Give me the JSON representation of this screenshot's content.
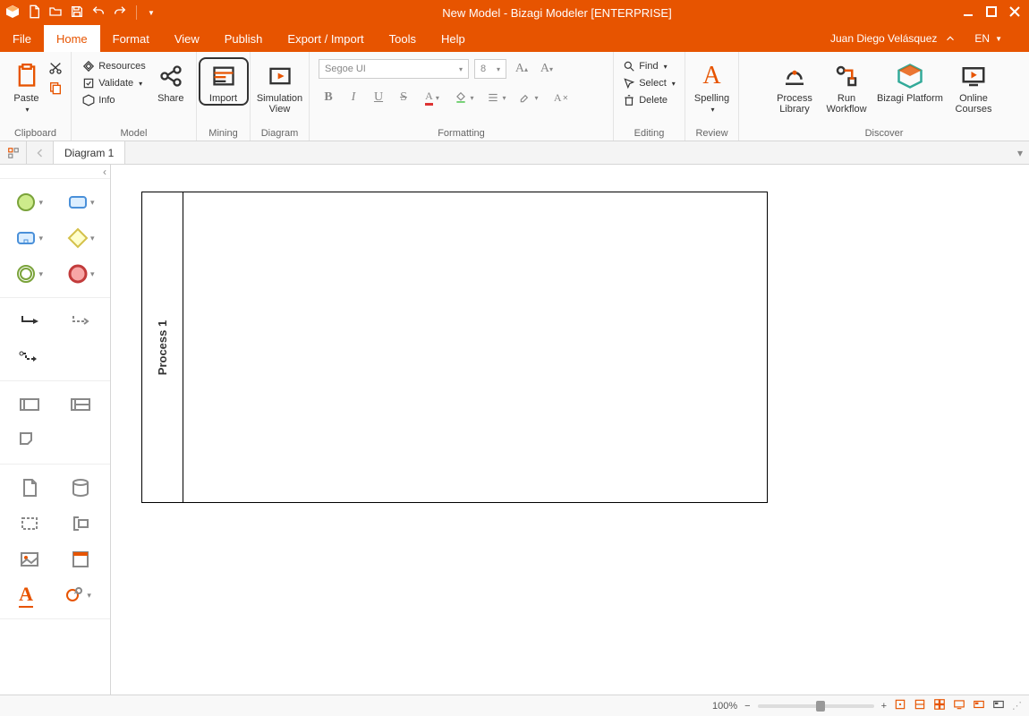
{
  "window": {
    "title": "New Model - Bizagi Modeler [ENTERPRISE]"
  },
  "menu": {
    "tabs": [
      "File",
      "Home",
      "Format",
      "View",
      "Publish",
      "Export / Import",
      "Tools",
      "Help"
    ],
    "active": 1,
    "user": "Juan Diego Velásquez",
    "lang": "EN"
  },
  "ribbon": {
    "clipboard": {
      "paste": "Paste",
      "label": "Clipboard"
    },
    "model": {
      "resources": "Resources",
      "validate": "Validate",
      "info": "Info",
      "share": "Share",
      "label": "Model"
    },
    "mining": {
      "import": "Import",
      "label": "Mining"
    },
    "diagram": {
      "simview": "Simulation View",
      "label": "Diagram"
    },
    "formatting": {
      "font": "Segoe UI",
      "size": "8",
      "label": "Formatting"
    },
    "editing": {
      "find": "Find",
      "select": "Select",
      "delete": "Delete",
      "label": "Editing"
    },
    "review": {
      "spelling": "Spelling",
      "label": "Review"
    },
    "discover": {
      "plib": "Process Library",
      "runwf": "Run Workflow",
      "platform": "Bizagi Platform",
      "courses": "Online Courses",
      "label": "Discover"
    }
  },
  "tabs": {
    "diagram1": "Diagram 1"
  },
  "canvas": {
    "pool_name": "Process 1"
  },
  "status": {
    "zoom": "100%"
  }
}
